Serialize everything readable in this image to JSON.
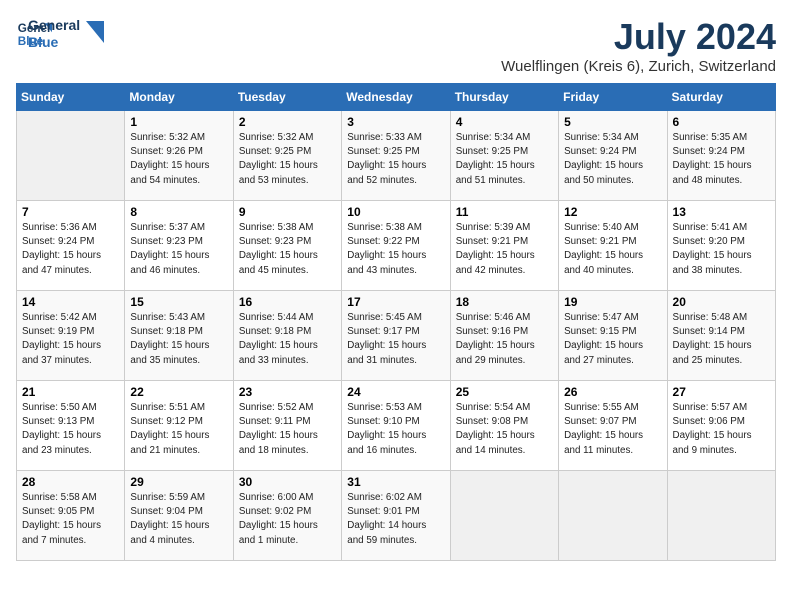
{
  "header": {
    "logo_line1": "General",
    "logo_line2": "Blue",
    "title": "July 2024",
    "subtitle": "Wuelflingen (Kreis 6), Zurich, Switzerland"
  },
  "columns": [
    "Sunday",
    "Monday",
    "Tuesday",
    "Wednesday",
    "Thursday",
    "Friday",
    "Saturday"
  ],
  "weeks": [
    [
      {
        "day": "",
        "info": ""
      },
      {
        "day": "1",
        "info": "Sunrise: 5:32 AM\nSunset: 9:26 PM\nDaylight: 15 hours\nand 54 minutes."
      },
      {
        "day": "2",
        "info": "Sunrise: 5:32 AM\nSunset: 9:25 PM\nDaylight: 15 hours\nand 53 minutes."
      },
      {
        "day": "3",
        "info": "Sunrise: 5:33 AM\nSunset: 9:25 PM\nDaylight: 15 hours\nand 52 minutes."
      },
      {
        "day": "4",
        "info": "Sunrise: 5:34 AM\nSunset: 9:25 PM\nDaylight: 15 hours\nand 51 minutes."
      },
      {
        "day": "5",
        "info": "Sunrise: 5:34 AM\nSunset: 9:24 PM\nDaylight: 15 hours\nand 50 minutes."
      },
      {
        "day": "6",
        "info": "Sunrise: 5:35 AM\nSunset: 9:24 PM\nDaylight: 15 hours\nand 48 minutes."
      }
    ],
    [
      {
        "day": "7",
        "info": "Sunrise: 5:36 AM\nSunset: 9:24 PM\nDaylight: 15 hours\nand 47 minutes."
      },
      {
        "day": "8",
        "info": "Sunrise: 5:37 AM\nSunset: 9:23 PM\nDaylight: 15 hours\nand 46 minutes."
      },
      {
        "day": "9",
        "info": "Sunrise: 5:38 AM\nSunset: 9:23 PM\nDaylight: 15 hours\nand 45 minutes."
      },
      {
        "day": "10",
        "info": "Sunrise: 5:38 AM\nSunset: 9:22 PM\nDaylight: 15 hours\nand 43 minutes."
      },
      {
        "day": "11",
        "info": "Sunrise: 5:39 AM\nSunset: 9:21 PM\nDaylight: 15 hours\nand 42 minutes."
      },
      {
        "day": "12",
        "info": "Sunrise: 5:40 AM\nSunset: 9:21 PM\nDaylight: 15 hours\nand 40 minutes."
      },
      {
        "day": "13",
        "info": "Sunrise: 5:41 AM\nSunset: 9:20 PM\nDaylight: 15 hours\nand 38 minutes."
      }
    ],
    [
      {
        "day": "14",
        "info": "Sunrise: 5:42 AM\nSunset: 9:19 PM\nDaylight: 15 hours\nand 37 minutes."
      },
      {
        "day": "15",
        "info": "Sunrise: 5:43 AM\nSunset: 9:18 PM\nDaylight: 15 hours\nand 35 minutes."
      },
      {
        "day": "16",
        "info": "Sunrise: 5:44 AM\nSunset: 9:18 PM\nDaylight: 15 hours\nand 33 minutes."
      },
      {
        "day": "17",
        "info": "Sunrise: 5:45 AM\nSunset: 9:17 PM\nDaylight: 15 hours\nand 31 minutes."
      },
      {
        "day": "18",
        "info": "Sunrise: 5:46 AM\nSunset: 9:16 PM\nDaylight: 15 hours\nand 29 minutes."
      },
      {
        "day": "19",
        "info": "Sunrise: 5:47 AM\nSunset: 9:15 PM\nDaylight: 15 hours\nand 27 minutes."
      },
      {
        "day": "20",
        "info": "Sunrise: 5:48 AM\nSunset: 9:14 PM\nDaylight: 15 hours\nand 25 minutes."
      }
    ],
    [
      {
        "day": "21",
        "info": "Sunrise: 5:50 AM\nSunset: 9:13 PM\nDaylight: 15 hours\nand 23 minutes."
      },
      {
        "day": "22",
        "info": "Sunrise: 5:51 AM\nSunset: 9:12 PM\nDaylight: 15 hours\nand 21 minutes."
      },
      {
        "day": "23",
        "info": "Sunrise: 5:52 AM\nSunset: 9:11 PM\nDaylight: 15 hours\nand 18 minutes."
      },
      {
        "day": "24",
        "info": "Sunrise: 5:53 AM\nSunset: 9:10 PM\nDaylight: 15 hours\nand 16 minutes."
      },
      {
        "day": "25",
        "info": "Sunrise: 5:54 AM\nSunset: 9:08 PM\nDaylight: 15 hours\nand 14 minutes."
      },
      {
        "day": "26",
        "info": "Sunrise: 5:55 AM\nSunset: 9:07 PM\nDaylight: 15 hours\nand 11 minutes."
      },
      {
        "day": "27",
        "info": "Sunrise: 5:57 AM\nSunset: 9:06 PM\nDaylight: 15 hours\nand 9 minutes."
      }
    ],
    [
      {
        "day": "28",
        "info": "Sunrise: 5:58 AM\nSunset: 9:05 PM\nDaylight: 15 hours\nand 7 minutes."
      },
      {
        "day": "29",
        "info": "Sunrise: 5:59 AM\nSunset: 9:04 PM\nDaylight: 15 hours\nand 4 minutes."
      },
      {
        "day": "30",
        "info": "Sunrise: 6:00 AM\nSunset: 9:02 PM\nDaylight: 15 hours\nand 1 minute."
      },
      {
        "day": "31",
        "info": "Sunrise: 6:02 AM\nSunset: 9:01 PM\nDaylight: 14 hours\nand 59 minutes."
      },
      {
        "day": "",
        "info": ""
      },
      {
        "day": "",
        "info": ""
      },
      {
        "day": "",
        "info": ""
      }
    ]
  ]
}
